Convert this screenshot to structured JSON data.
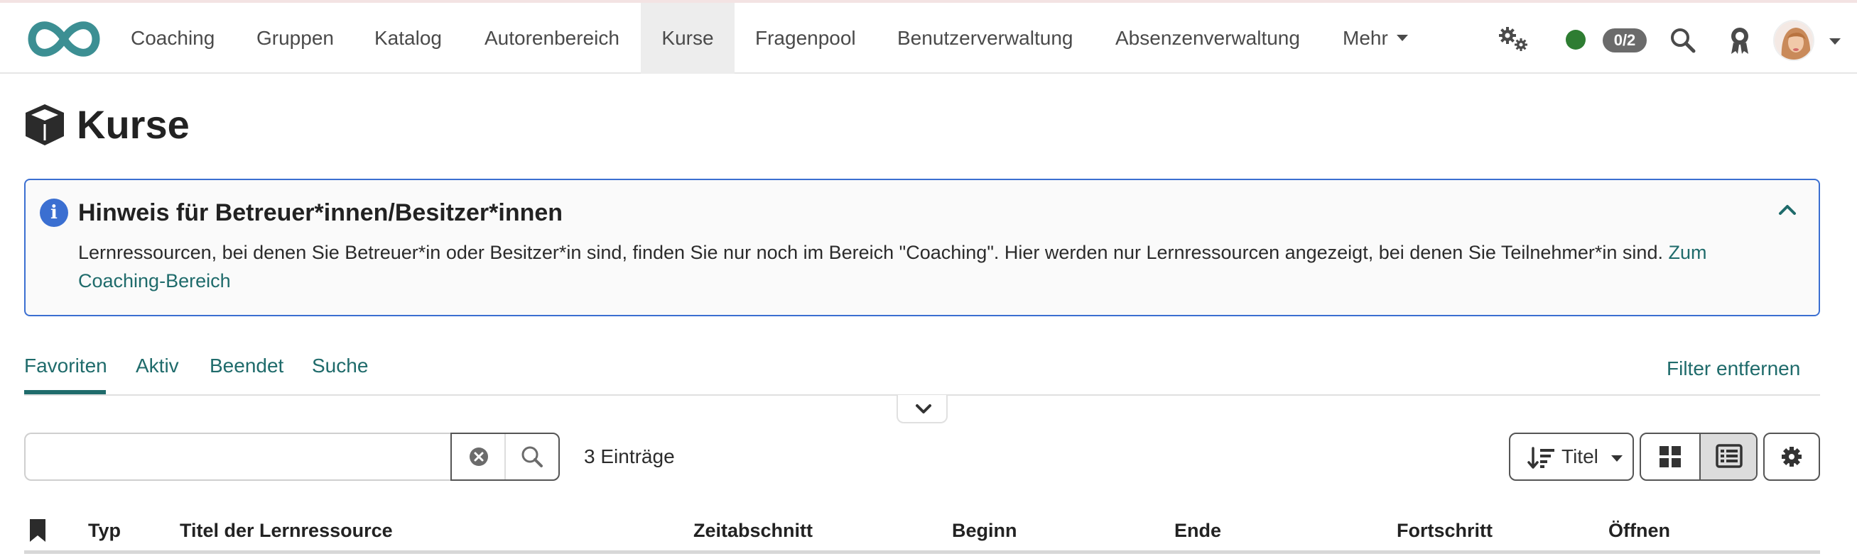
{
  "navbar": {
    "items": [
      {
        "label": "Coaching"
      },
      {
        "label": "Gruppen"
      },
      {
        "label": "Katalog"
      },
      {
        "label": "Autorenbereich"
      },
      {
        "label": "Kurse"
      },
      {
        "label": "Fragenpool"
      },
      {
        "label": "Benutzerverwaltung"
      },
      {
        "label": "Absenzenverwaltung"
      },
      {
        "label": "Mehr"
      }
    ],
    "active_item": "Kurse",
    "status_badge": "0/2",
    "status_color": "#2e7d32",
    "icons": [
      "infinity-logo-icon",
      "gears-icon",
      "search-icon",
      "award-icon",
      "avatar",
      "chevron-down-icon"
    ]
  },
  "page": {
    "title": "Kurse",
    "title_icon": "cube-icon"
  },
  "notice": {
    "title": "Hinweis für Betreuer*innen/Besitzer*innen",
    "text": "Lernressourcen, bei denen Sie Betreuer*in oder Besitzer*in sind, finden Sie nur noch im Bereich \"Coaching\". Hier werden nur Lernressourcen angezeigt, bei denen Sie Teilnehmer*in sind.",
    "link": "Zum Coaching-Bereich",
    "border_color": "#3b6fd1"
  },
  "tabs": {
    "items": [
      {
        "label": "Favoriten"
      },
      {
        "label": "Aktiv"
      },
      {
        "label": "Beendet"
      },
      {
        "label": "Suche"
      }
    ],
    "active": "Favoriten",
    "filter_remove": "Filter entfernen",
    "accent_color": "#1f6b6b"
  },
  "search": {
    "value": "",
    "placeholder": "",
    "entries": "3 Einträge"
  },
  "toolbar": {
    "sort_label": "Titel",
    "views": [
      "grid-view-icon",
      "list-view-icon"
    ],
    "active_view": "list-view-icon"
  },
  "table": {
    "columns": [
      "Typ",
      "Titel der Lernressource",
      "Zeitabschnitt",
      "Beginn",
      "Ende",
      "Fortschritt",
      "Öffnen"
    ]
  }
}
